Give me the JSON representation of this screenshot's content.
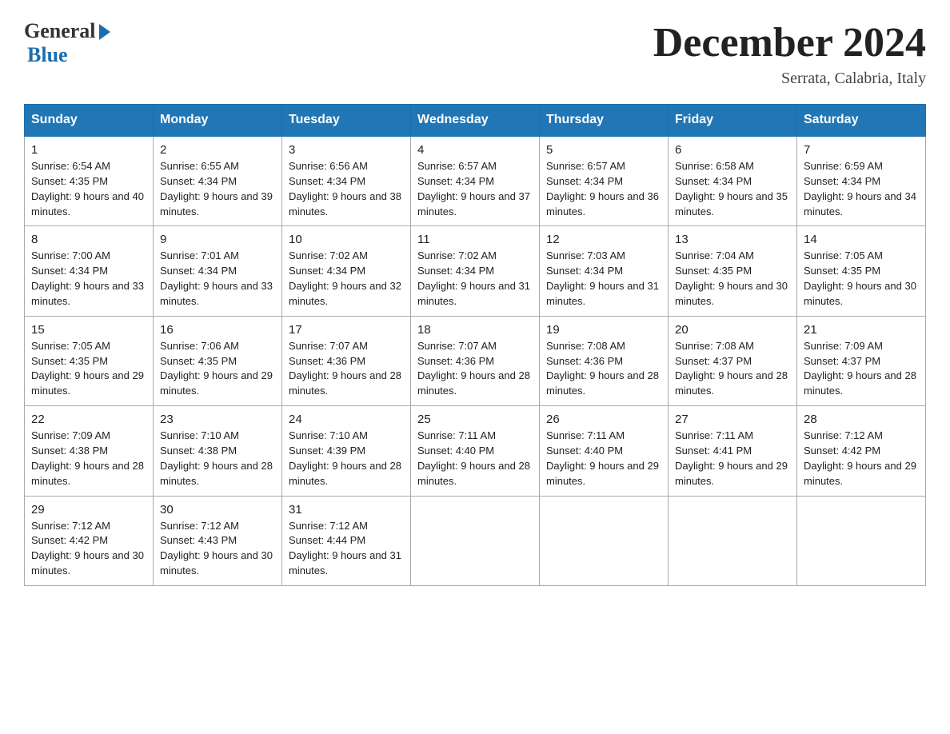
{
  "header": {
    "logo_general": "General",
    "logo_blue": "Blue",
    "month_title": "December 2024",
    "location": "Serrata, Calabria, Italy"
  },
  "days_of_week": [
    "Sunday",
    "Monday",
    "Tuesday",
    "Wednesday",
    "Thursday",
    "Friday",
    "Saturday"
  ],
  "weeks": [
    [
      {
        "day": "1",
        "sunrise": "6:54 AM",
        "sunset": "4:35 PM",
        "daylight": "9 hours and 40 minutes."
      },
      {
        "day": "2",
        "sunrise": "6:55 AM",
        "sunset": "4:34 PM",
        "daylight": "9 hours and 39 minutes."
      },
      {
        "day": "3",
        "sunrise": "6:56 AM",
        "sunset": "4:34 PM",
        "daylight": "9 hours and 38 minutes."
      },
      {
        "day": "4",
        "sunrise": "6:57 AM",
        "sunset": "4:34 PM",
        "daylight": "9 hours and 37 minutes."
      },
      {
        "day": "5",
        "sunrise": "6:57 AM",
        "sunset": "4:34 PM",
        "daylight": "9 hours and 36 minutes."
      },
      {
        "day": "6",
        "sunrise": "6:58 AM",
        "sunset": "4:34 PM",
        "daylight": "9 hours and 35 minutes."
      },
      {
        "day": "7",
        "sunrise": "6:59 AM",
        "sunset": "4:34 PM",
        "daylight": "9 hours and 34 minutes."
      }
    ],
    [
      {
        "day": "8",
        "sunrise": "7:00 AM",
        "sunset": "4:34 PM",
        "daylight": "9 hours and 33 minutes."
      },
      {
        "day": "9",
        "sunrise": "7:01 AM",
        "sunset": "4:34 PM",
        "daylight": "9 hours and 33 minutes."
      },
      {
        "day": "10",
        "sunrise": "7:02 AM",
        "sunset": "4:34 PM",
        "daylight": "9 hours and 32 minutes."
      },
      {
        "day": "11",
        "sunrise": "7:02 AM",
        "sunset": "4:34 PM",
        "daylight": "9 hours and 31 minutes."
      },
      {
        "day": "12",
        "sunrise": "7:03 AM",
        "sunset": "4:34 PM",
        "daylight": "9 hours and 31 minutes."
      },
      {
        "day": "13",
        "sunrise": "7:04 AM",
        "sunset": "4:35 PM",
        "daylight": "9 hours and 30 minutes."
      },
      {
        "day": "14",
        "sunrise": "7:05 AM",
        "sunset": "4:35 PM",
        "daylight": "9 hours and 30 minutes."
      }
    ],
    [
      {
        "day": "15",
        "sunrise": "7:05 AM",
        "sunset": "4:35 PM",
        "daylight": "9 hours and 29 minutes."
      },
      {
        "day": "16",
        "sunrise": "7:06 AM",
        "sunset": "4:35 PM",
        "daylight": "9 hours and 29 minutes."
      },
      {
        "day": "17",
        "sunrise": "7:07 AM",
        "sunset": "4:36 PM",
        "daylight": "9 hours and 28 minutes."
      },
      {
        "day": "18",
        "sunrise": "7:07 AM",
        "sunset": "4:36 PM",
        "daylight": "9 hours and 28 minutes."
      },
      {
        "day": "19",
        "sunrise": "7:08 AM",
        "sunset": "4:36 PM",
        "daylight": "9 hours and 28 minutes."
      },
      {
        "day": "20",
        "sunrise": "7:08 AM",
        "sunset": "4:37 PM",
        "daylight": "9 hours and 28 minutes."
      },
      {
        "day": "21",
        "sunrise": "7:09 AM",
        "sunset": "4:37 PM",
        "daylight": "9 hours and 28 minutes."
      }
    ],
    [
      {
        "day": "22",
        "sunrise": "7:09 AM",
        "sunset": "4:38 PM",
        "daylight": "9 hours and 28 minutes."
      },
      {
        "day": "23",
        "sunrise": "7:10 AM",
        "sunset": "4:38 PM",
        "daylight": "9 hours and 28 minutes."
      },
      {
        "day": "24",
        "sunrise": "7:10 AM",
        "sunset": "4:39 PM",
        "daylight": "9 hours and 28 minutes."
      },
      {
        "day": "25",
        "sunrise": "7:11 AM",
        "sunset": "4:40 PM",
        "daylight": "9 hours and 28 minutes."
      },
      {
        "day": "26",
        "sunrise": "7:11 AM",
        "sunset": "4:40 PM",
        "daylight": "9 hours and 29 minutes."
      },
      {
        "day": "27",
        "sunrise": "7:11 AM",
        "sunset": "4:41 PM",
        "daylight": "9 hours and 29 minutes."
      },
      {
        "day": "28",
        "sunrise": "7:12 AM",
        "sunset": "4:42 PM",
        "daylight": "9 hours and 29 minutes."
      }
    ],
    [
      {
        "day": "29",
        "sunrise": "7:12 AM",
        "sunset": "4:42 PM",
        "daylight": "9 hours and 30 minutes."
      },
      {
        "day": "30",
        "sunrise": "7:12 AM",
        "sunset": "4:43 PM",
        "daylight": "9 hours and 30 minutes."
      },
      {
        "day": "31",
        "sunrise": "7:12 AM",
        "sunset": "4:44 PM",
        "daylight": "9 hours and 31 minutes."
      },
      null,
      null,
      null,
      null
    ]
  ]
}
